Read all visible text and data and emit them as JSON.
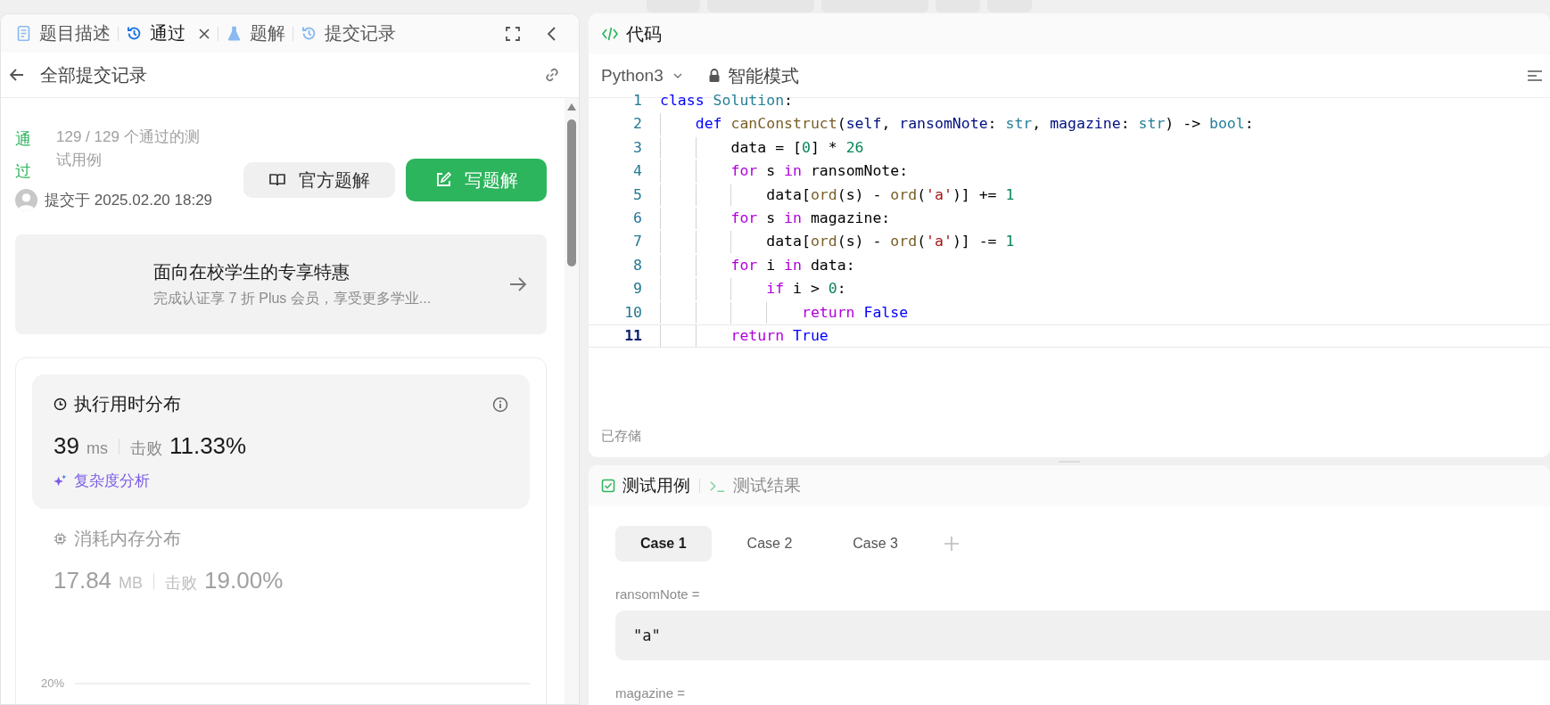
{
  "left_panel": {
    "tabs": [
      {
        "label": "题目描述",
        "kind": "document",
        "selected": false,
        "closable": false
      },
      {
        "label": "通过",
        "kind": "history",
        "selected": true,
        "closable": true
      },
      {
        "label": "题解",
        "kind": "flask",
        "selected": false,
        "closable": false
      },
      {
        "label": "提交记录",
        "kind": "history",
        "selected": false,
        "closable": false
      }
    ],
    "header": {
      "title": "全部提交记录"
    },
    "submission": {
      "status": "通过",
      "testcases": "129 / 129 个通过的测试用例",
      "submitted": "提交于 2025.02.20 18:29",
      "buttons": [
        {
          "label": "官方题解",
          "kind": "secondary"
        },
        {
          "label": "写题解",
          "kind": "primary"
        }
      ]
    },
    "promo": {
      "title": "面向在校学生的专享特惠",
      "subtitle": "完成认证享 7 折 Plus 会员，享受更多学业..."
    },
    "distributions": [
      {
        "kind": "time",
        "title": "执行用时分布",
        "value": "39",
        "unit": "ms",
        "beat_label": "击败",
        "beat": "11.33%",
        "link": "复杂度分析",
        "selected": true
      },
      {
        "kind": "memory",
        "title": "消耗内存分布",
        "value": "17.84",
        "unit": "MB",
        "beat_label": "击败",
        "beat": "19.00%",
        "selected": false
      }
    ],
    "chart_axis_label": "20%"
  },
  "editor": {
    "title": "代码",
    "language": "Python3",
    "mode": "智能模式",
    "lines": [
      {
        "number": "1",
        "current": false,
        "tokens": [
          {
            "text": "class",
            "kind": "keyword"
          },
          {
            "text": " Solution",
            "kind": "type"
          },
          {
            "text": ":",
            "kind": "plain"
          }
        ]
      },
      {
        "number": "2",
        "current": false,
        "tokens": [
          {
            "text": "    def",
            "kind": "keyword"
          },
          {
            "text": " canConstruct",
            "kind": "function"
          },
          {
            "text": "(",
            "kind": "plain"
          },
          {
            "text": "self",
            "kind": "variable"
          },
          {
            "text": ", ",
            "kind": "plain"
          },
          {
            "text": "ransomNote",
            "kind": "variable"
          },
          {
            "text": ": ",
            "kind": "plain"
          },
          {
            "text": "str",
            "kind": "type"
          },
          {
            "text": ", ",
            "kind": "plain"
          },
          {
            "text": "magazine",
            "kind": "variable"
          },
          {
            "text": ": ",
            "kind": "plain"
          },
          {
            "text": "str",
            "kind": "type"
          },
          {
            "text": ") -> ",
            "kind": "plain"
          },
          {
            "text": "bool",
            "kind": "type"
          },
          {
            "text": ":",
            "kind": "plain"
          }
        ]
      },
      {
        "number": "3",
        "current": false,
        "tokens": [
          {
            "text": "        data = [",
            "kind": "plain"
          },
          {
            "text": "0",
            "kind": "number"
          },
          {
            "text": "] * ",
            "kind": "plain"
          },
          {
            "text": "26",
            "kind": "number"
          }
        ]
      },
      {
        "number": "4",
        "current": false,
        "tokens": [
          {
            "text": "        for",
            "kind": "control"
          },
          {
            "text": " s ",
            "kind": "plain"
          },
          {
            "text": "in",
            "kind": "control"
          },
          {
            "text": " ransomNote:",
            "kind": "plain"
          }
        ]
      },
      {
        "number": "5",
        "current": false,
        "tokens": [
          {
            "text": "            data[",
            "kind": "plain"
          },
          {
            "text": "ord",
            "kind": "function"
          },
          {
            "text": "(s) - ",
            "kind": "plain"
          },
          {
            "text": "ord",
            "kind": "function"
          },
          {
            "text": "(",
            "kind": "plain"
          },
          {
            "text": "'a'",
            "kind": "string"
          },
          {
            "text": ")] += ",
            "kind": "plain"
          },
          {
            "text": "1",
            "kind": "number"
          }
        ]
      },
      {
        "number": "6",
        "current": false,
        "tokens": [
          {
            "text": "        for",
            "kind": "control"
          },
          {
            "text": " s ",
            "kind": "plain"
          },
          {
            "text": "in",
            "kind": "control"
          },
          {
            "text": " magazine:",
            "kind": "plain"
          }
        ]
      },
      {
        "number": "7",
        "current": false,
        "tokens": [
          {
            "text": "            data[",
            "kind": "plain"
          },
          {
            "text": "ord",
            "kind": "function"
          },
          {
            "text": "(s) - ",
            "kind": "plain"
          },
          {
            "text": "ord",
            "kind": "function"
          },
          {
            "text": "(",
            "kind": "plain"
          },
          {
            "text": "'a'",
            "kind": "string"
          },
          {
            "text": ")] -= ",
            "kind": "plain"
          },
          {
            "text": "1",
            "kind": "number"
          }
        ]
      },
      {
        "number": "8",
        "current": false,
        "tokens": [
          {
            "text": "        for",
            "kind": "control"
          },
          {
            "text": " i ",
            "kind": "plain"
          },
          {
            "text": "in",
            "kind": "control"
          },
          {
            "text": " data:",
            "kind": "plain"
          }
        ]
      },
      {
        "number": "9",
        "current": false,
        "tokens": [
          {
            "text": "            if",
            "kind": "control"
          },
          {
            "text": " i > ",
            "kind": "plain"
          },
          {
            "text": "0",
            "kind": "number"
          },
          {
            "text": ":",
            "kind": "plain"
          }
        ]
      },
      {
        "number": "10",
        "current": false,
        "tokens": [
          {
            "text": "                return",
            "kind": "control"
          },
          {
            "text": " False",
            "kind": "constant"
          }
        ]
      },
      {
        "number": "11",
        "current": true,
        "tokens": [
          {
            "text": "        return",
            "kind": "control"
          },
          {
            "text": " True",
            "kind": "constant"
          }
        ]
      }
    ],
    "saved": "已存储"
  },
  "test_panel": {
    "tabs": [
      {
        "label": "测试用例",
        "kind": "checklist",
        "selected": true
      },
      {
        "label": "测试结果",
        "kind": "console",
        "selected": false
      }
    ],
    "cases": [
      {
        "label": "Case 1",
        "selected": true
      },
      {
        "label": "Case 2",
        "selected": false
      },
      {
        "label": "Case 3",
        "selected": false
      }
    ],
    "inputs": [
      {
        "name": "ransomNote =",
        "value": "\"a\""
      },
      {
        "name": "magazine ="
      }
    ]
  }
}
